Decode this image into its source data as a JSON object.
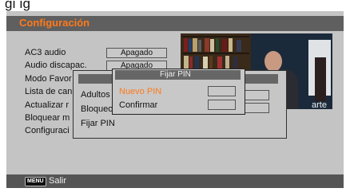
{
  "page_title": "gi ig",
  "header": {
    "title": "Configuración"
  },
  "menu": {
    "items": [
      "AC3 audio",
      "Audio discapac.",
      "Modo Favor",
      "Lista de can",
      "Actualizar r",
      "Bloquear m",
      "Configuraci"
    ],
    "values": [
      "Apagado",
      "Apagado"
    ]
  },
  "preview": {
    "channel_logo": "arte"
  },
  "parental_dialog": {
    "items": [
      "Adultos",
      "Bloqueo",
      "Fijar PIN"
    ]
  },
  "pin_dialog": {
    "title": "Fijar PIN",
    "new_pin_label": "Nuevo PIN",
    "confirm_label": "Confirmar",
    "new_pin_value": "",
    "confirm_value": ""
  },
  "footer": {
    "menu_key": "MENU",
    "exit_label": "Salir"
  },
  "colors": {
    "highlight": "#ff7a1a",
    "screen_bg": "#c4c4c4",
    "bar_bg": "#5f5f5f"
  }
}
